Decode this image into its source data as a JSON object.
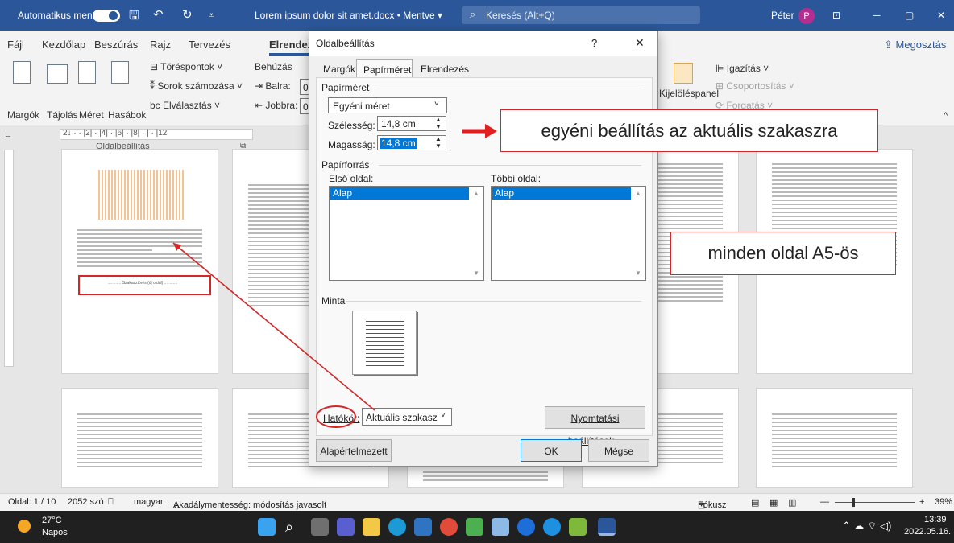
{
  "titlebar": {
    "autosave": "Automatikus mentés",
    "doc": "Lorem ipsum dolor sit amet.docx • Mentve ▾",
    "search_placeholder": "Keresés (Alt+Q)",
    "user": "Péter",
    "avatar": "P"
  },
  "ribbon": {
    "tabs": [
      "Fájl",
      "Kezdőlap",
      "Beszúrás",
      "Rajz",
      "Tervezés",
      "Elrendez"
    ],
    "share": "Megosztás",
    "group_label": "Oldalbeállítás",
    "big_buttons": [
      "Margók",
      "Tájolás",
      "Méret",
      "Hasábok"
    ],
    "small_buttons": [
      "Töréspontok ˅",
      "Sorok számozása ˅",
      "Elválasztás ˅"
    ],
    "indent": "Behúzás",
    "left": "Balra:",
    "right": "Jobbra:",
    "left_val": "0",
    "right_val": "0",
    "align": "Igazítás ˅",
    "group_btn": "Csoportosítás ˅",
    "rotate": "Forgatás ˅",
    "selpane": "Kijelölés­panel"
  },
  "ruler_text": "2↓ · · |2| · |4| · |6| · |8| · | · |12",
  "page1": {
    "pilcrow": "¶",
    "section_break": "Szakasztörés (új oldal)"
  },
  "dialog": {
    "title": "Oldalbeállítás",
    "help": "?",
    "close": "✕",
    "tabs": [
      "Margók",
      "Papírméret",
      "Elrendezés"
    ],
    "paper_section": "Papírméret",
    "size_value": "Egyéni méret",
    "width_label": "Szélesség:",
    "width_value": "14,8 cm",
    "height_label": "Magasság:",
    "height_value": "14,8 cm",
    "source_section": "Papírforrás",
    "first_page": "Első oldal:",
    "other_pages": "Többi oldal:",
    "first_selected": "Alap",
    "other_selected": "Alap",
    "preview": "Minta",
    "scope_label": "Hatókör:",
    "scope_value": "Aktuális szakasz",
    "print_btn": "Nyomtatási beállítások...",
    "default_btn": "Alapértelmezett",
    "ok": "OK",
    "cancel": "Mégse"
  },
  "callouts": {
    "top": "egyéni beállítás az aktuális szakaszra",
    "mid": "minden oldal A5-ös"
  },
  "status": {
    "page": "Oldal: 1 / 10",
    "words": "2052 szó",
    "lang": "magyar",
    "access": "Akadálymentesség: módosítás javasolt",
    "focus": "Fókusz",
    "zoom": "39%",
    "minus": "—",
    "plus": "+"
  },
  "taskbar": {
    "temp": "27°C",
    "weather": "Napos",
    "time": "13:39",
    "date": "2022.05.16."
  },
  "colors": {
    "word_blue": "#2b579a",
    "callout_red": "#d32626",
    "selection": "#0078d7"
  }
}
